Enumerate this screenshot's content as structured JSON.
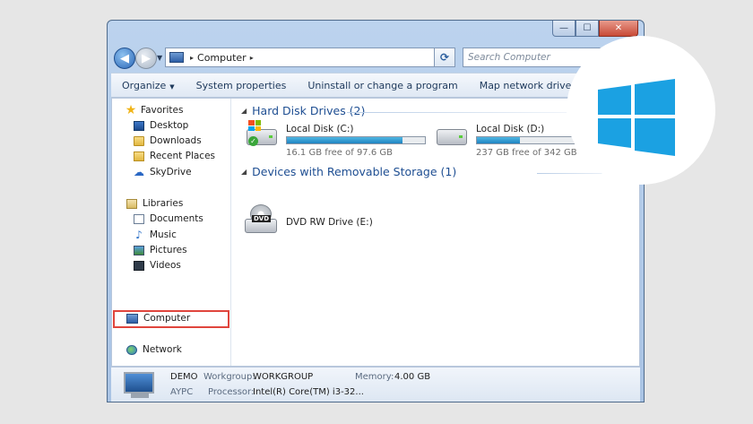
{
  "window": {
    "controls": {
      "minimize": "—",
      "maximize": "☐",
      "close": "✕"
    }
  },
  "address": {
    "separator": "▸",
    "location": "Computer",
    "trail_arrow": "▸",
    "dropdown": "▾",
    "refresh": "⟳"
  },
  "search": {
    "placeholder": "Search Computer"
  },
  "toolbar": {
    "organize": "Organize",
    "system_properties": "System properties",
    "uninstall": "Uninstall or change a program",
    "map_drive": "Map network drive",
    "more": "»"
  },
  "nav": {
    "favorites": "Favorites",
    "desktop": "Desktop",
    "downloads": "Downloads",
    "recent": "Recent Places",
    "skydrive": "SkyDrive",
    "libraries": "Libraries",
    "documents": "Documents",
    "music": "Music",
    "pictures": "Pictures",
    "videos": "Videos",
    "computer": "Computer",
    "network": "Network"
  },
  "hard_disks": {
    "header": "Hard Disk Drives (2)",
    "drives": [
      {
        "name": "Local Disk (C:)",
        "free": "16.1 GB free of 97.6 GB",
        "used_fraction": 0.835
      },
      {
        "name": "Local Disk (D:)",
        "free": "237 GB free of 342 GB",
        "used_fraction": 0.31
      }
    ]
  },
  "removable": {
    "header": "Devices with Removable Storage (1)",
    "dvd_name": "DVD RW Drive (E:)",
    "dvd_badge": "DVD"
  },
  "details": {
    "name": "DEMO",
    "workgroup_label": "Workgroup:",
    "workgroup": "WORKGROUP",
    "memory_label": "Memory:",
    "memory": "4.00 GB",
    "subname": "AYPC",
    "processor_label": "Processor:",
    "processor": "Intel(R) Core(TM) i3-32..."
  },
  "colors": {
    "highlight": "#e0453d",
    "windows_logo": "#1ba1e2",
    "drive_fill": "#1f83c1"
  }
}
